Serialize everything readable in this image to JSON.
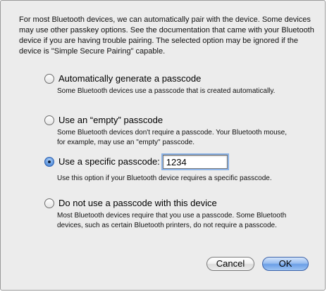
{
  "intro_text": "For most Bluetooth devices, we can automatically pair with the device. Some devices may use other passkey options. See the documentation that came with your Bluetooth device if you are having trouble pairing. The selected option may be ignored if the device is \"Simple Secure Pairing\" capable.",
  "options": [
    {
      "label": "Automatically generate a passcode",
      "description": "Some Bluetooth devices use a passcode that is created automatically.",
      "selected": false
    },
    {
      "label": "Use an “empty” passcode",
      "description": "Some Bluetooth devices don't require a passcode. Your Bluetooth mouse, for example, may use an \"empty\" passcode.",
      "selected": false
    },
    {
      "label": "Use a specific passcode:",
      "description": "Use this option if your Bluetooth device requires a specific passcode.",
      "selected": true,
      "passcode_value": "1234"
    },
    {
      "label": "Do not use a passcode with this device",
      "description": "Most Bluetooth devices require that you use a passcode. Some Bluetooth devices, such as certain Bluetooth printers, do not require a passcode.",
      "selected": false
    }
  ],
  "buttons": {
    "cancel_label": "Cancel",
    "ok_label": "OK"
  },
  "colors": {
    "dialog_background": "#ececec",
    "default_button": "#6b9fe6",
    "focus_ring": "#8cb3e6"
  }
}
